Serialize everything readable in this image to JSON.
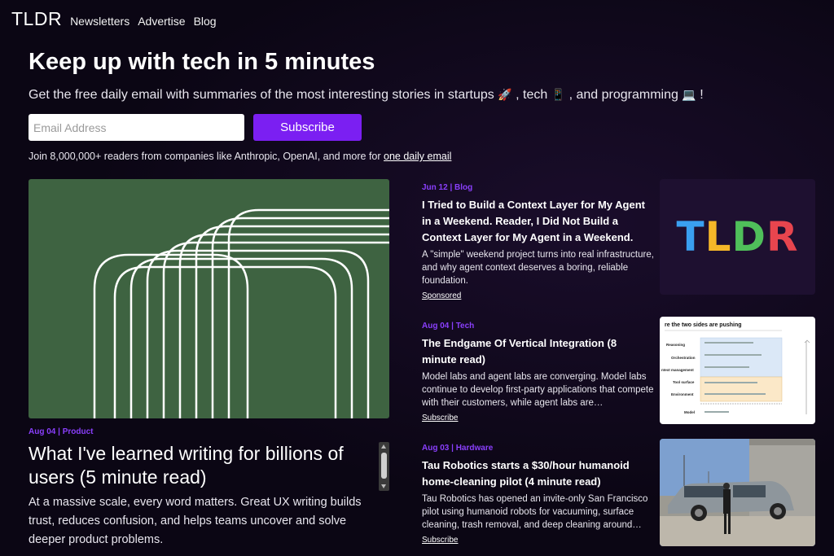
{
  "nav": {
    "logo": "TLDR",
    "links": [
      "Newsletters",
      "Advertise",
      "Blog"
    ]
  },
  "hero": {
    "title": "Keep up with tech in 5 minutes",
    "subtitle_parts": [
      "Get the free daily email with summaries of the most interesting stories in startups ",
      "🚀",
      " , tech ",
      "📱",
      " , and programming ",
      "💻",
      " !"
    ],
    "email_placeholder": "Email Address",
    "subscribe_label": "Subscribe",
    "join_text": "Join 8,000,000+ readers from companies like Anthropic, OpenAI, and more for ",
    "join_link": "one daily email"
  },
  "feature": {
    "meta": "Aug 04 | Product",
    "title": "What I've learned writing for billions of users (5 minute read)",
    "description": "At a massive scale, every word matters. Great UX writing builds trust, reduces confusion, and helps teams uncover and solve deeper product problems."
  },
  "stories": [
    {
      "meta": "Jun 12 | Blog",
      "title": "I Tried to Build a Context Layer for My Agent in a Weekend. Reader, I Did Not Build a Context Layer for My Agent in a Weekend.",
      "description": "A \"simple\" weekend project turns into real infrastructure, and why agent context deserves a boring, reliable foundation.",
      "link": "Sponsored"
    },
    {
      "meta": "Aug 04 | Tech",
      "title": "The Endgame Of Vertical Integration (8 minute read)",
      "description": "Model labs and agent labs are converging. Model labs continue to develop first-party applications that compete with their customers, while agent labs are…",
      "link": "Subscribe"
    },
    {
      "meta": "Aug 03 | Hardware",
      "title": "Tau Robotics starts a $30/hour humanoid home-cleaning pilot (4 minute read)",
      "description": "Tau Robotics has opened an invite-only San Francisco pilot using humanoid robots for vacuuming, surface cleaning, trash removal, and deep cleaning around…",
      "link": "Subscribe"
    }
  ],
  "thumb1": {
    "logo_letters": [
      "T",
      "L",
      "D",
      "R"
    ],
    "logo_colors": [
      "#3aa0f0",
      "#f5b728",
      "#4fbf5a",
      "#e8454e"
    ]
  },
  "thumb2": {
    "heading": "re the two sides are pushing",
    "rows": [
      "Reasoning",
      "Orchestration",
      "ntext management",
      "Tool surface",
      "Environment",
      "Model"
    ]
  },
  "colors": {
    "accent": "#7b1ff2",
    "meta": "#8a3ffc",
    "feature_bg": "#3e6341"
  }
}
